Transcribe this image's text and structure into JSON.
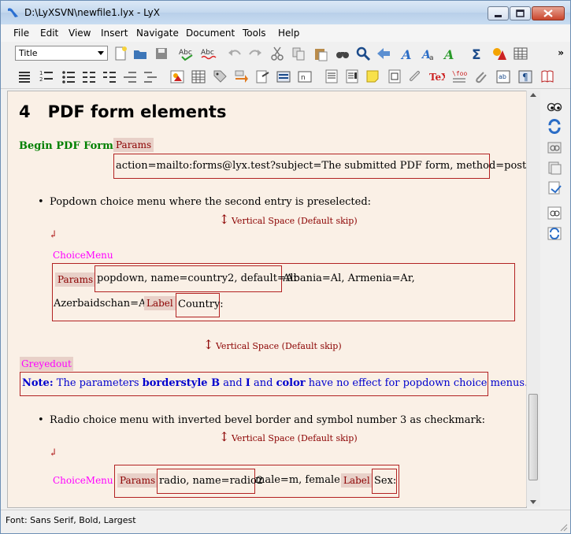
{
  "window": {
    "title": "D:\\LyXSVN\\newfile1.lyx - LyX"
  },
  "menu": [
    "File",
    "Edit",
    "View",
    "Insert",
    "Navigate",
    "Document",
    "Tools",
    "Help"
  ],
  "toolbar": {
    "layout_value": "Title",
    "overflow": "»"
  },
  "document": {
    "heading_number": "4",
    "heading_title": "PDF form elements",
    "begin_form_label": "Begin PDF Form",
    "params_tag": "Params",
    "form_params_value": "action=mailto:forms@lyx.test?subject=The submitted PDF form, method=post",
    "item1_text": "Popdown choice menu where the second entry is preselected:",
    "vspace_label": "Vertical Space (Default skip)",
    "choicemenu_tag": "ChoiceMenu",
    "choice1_params_value": "popdown, name=country2, default=Ar",
    "choice1_options_line1": "Albania=Al, Armenia=Ar,",
    "choice1_options_line2": "Azerbaidschan=Az",
    "label_tag": "Label",
    "choice1_label_value": "Country:",
    "greyedout_tag": "Greyedout",
    "note_label": "Note:",
    "note_text_1": " The parameters ",
    "note_bold_1": "borderstyle B",
    "note_text_2": " and ",
    "note_bold_2": "I",
    "note_text_3": " and ",
    "note_bold_3": "color",
    "note_text_4": " have no effect for popdown choice menus.",
    "item2_text": "Radio choice menu with inverted bevel border and symbol number 3 as checkmark:",
    "choice2_params_value": "radio, name=radio2",
    "choice2_options": "male=m, female=f",
    "choice2_label_value": "Sex:",
    "paragraph_mark": "↲",
    "bullet": "•"
  },
  "status": {
    "text": "Font: Sans Serif, Bold, Largest"
  },
  "colors": {
    "editor_bg": "#faf0e6",
    "inset_border": "#b22222",
    "green_label": "#008000",
    "inset_tag_text": "#8b0000",
    "magenta_tag": "#ff00ff",
    "note_blue": "#0000cd"
  }
}
